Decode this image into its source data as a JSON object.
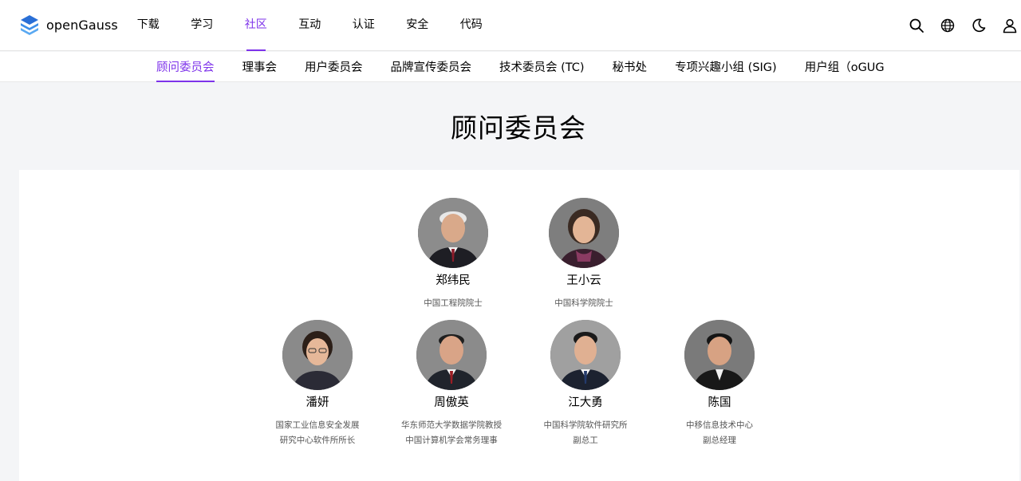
{
  "brand": {
    "name": "openGauss",
    "accent": "#7d32ea"
  },
  "nav": {
    "items": [
      {
        "label": "下载"
      },
      {
        "label": "学习"
      },
      {
        "label": "社区",
        "active": true
      },
      {
        "label": "互动"
      },
      {
        "label": "认证"
      },
      {
        "label": "安全"
      },
      {
        "label": "代码"
      }
    ]
  },
  "tools": [
    "search-icon",
    "language-icon",
    "theme-moon-icon",
    "user-icon"
  ],
  "subnav": {
    "items": [
      {
        "label": "顾问委员会",
        "active": true
      },
      {
        "label": "理事会"
      },
      {
        "label": "用户委员会"
      },
      {
        "label": "品牌宣传委员会"
      },
      {
        "label": "技术委员会 (TC)"
      },
      {
        "label": "秘书处"
      },
      {
        "label": "专项兴趣小组 (SIG)"
      },
      {
        "label": "用户组（oGUG"
      }
    ]
  },
  "page": {
    "title": "顾问委员会"
  },
  "members": [
    {
      "name": "郑纬民",
      "title_lines": [
        "中国工程院院士"
      ]
    },
    {
      "name": "王小云",
      "title_lines": [
        "中国科学院院士"
      ]
    },
    {
      "name": "潘妍",
      "title_lines": [
        "国家工业信息安全发展",
        "研究中心软件所所长"
      ]
    },
    {
      "name": "周傲英",
      "title_lines": [
        "华东师范大学数据学院教授",
        "中国计算机学会常务理事"
      ]
    },
    {
      "name": "江大勇",
      "title_lines": [
        "中国科学院软件研究所",
        "副总工"
      ]
    },
    {
      "name": "陈国",
      "title_lines": [
        "中移信息技术中心",
        "副总经理"
      ]
    }
  ]
}
